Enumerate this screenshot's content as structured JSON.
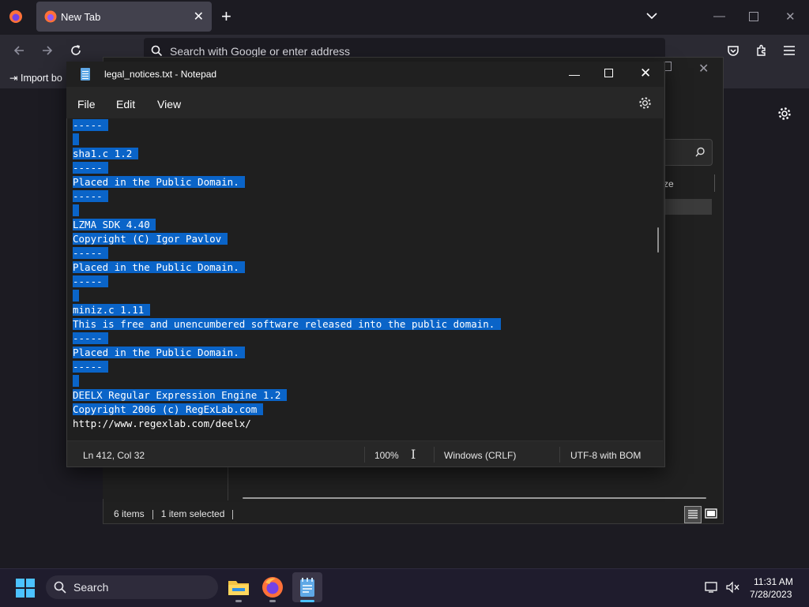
{
  "firefox": {
    "tab_title": "New Tab",
    "url_placeholder": "Search with Google or enter address",
    "bookmark_import_label": "Import bo"
  },
  "explorer": {
    "column_size_label": "ze",
    "status_items": "6 items",
    "status_selected": "1 item selected"
  },
  "notepad": {
    "window_title": "legal_notices.txt - Notepad",
    "menu": [
      "File",
      "Edit",
      "View"
    ],
    "lines": [
      "-----",
      "",
      "sha1.c 1.2",
      "-----",
      "Placed in the Public Domain.",
      "-----",
      "",
      "LZMA SDK 4.40",
      "Copyright (C) Igor Pavlov",
      "-----",
      "Placed in the Public Domain.",
      "-----",
      "",
      "miniz.c 1.11",
      "This is free and unencumbered software released into the public domain.",
      "-----",
      "Placed in the Public Domain.",
      "-----",
      "",
      "DEELX Regular Expression Engine 1.2",
      "Copyright 2006 (c) RegExLab.com",
      "http://www.regexlab.com/deelx/"
    ],
    "selected_line_count": 21,
    "status": {
      "position": "Ln 412, Col 32",
      "zoom": "100%",
      "line_endings": "Windows (CRLF)",
      "encoding": "UTF-8 with BOM"
    }
  },
  "taskbar": {
    "search_label": "Search",
    "time": "11:31 AM",
    "date": "7/28/2023"
  },
  "colors": {
    "selection": "#0a64c8",
    "notepad_bg": "#1f1f1f",
    "taskbar_bg": "#1f1c2d",
    "firefox_toolbar": "#2b2a33"
  }
}
